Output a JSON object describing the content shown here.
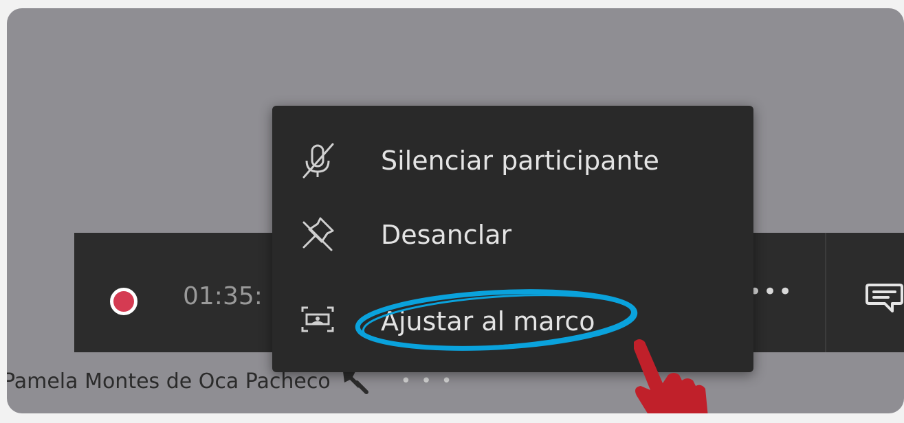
{
  "call_bar": {
    "timer": "01:35:",
    "more_label": "•••"
  },
  "participant": {
    "name": "Pamela Montes de Oca Pacheco",
    "more_label": "• • •"
  },
  "context_menu": {
    "items": [
      {
        "label": "Silenciar participante",
        "icon": "mic-off-icon"
      },
      {
        "label": "Desanclar",
        "icon": "unpin-icon"
      },
      {
        "label": "Ajustar al marco",
        "icon": "fit-to-frame-icon"
      }
    ]
  },
  "colors": {
    "stage_background": "#8f8e93",
    "menu_background": "#292929",
    "call_bar_background": "#2c2c2c",
    "record_dot": "#d53b52",
    "highlight_ellipse": "#0aa2dc",
    "pointer_hand": "#c0202a"
  }
}
